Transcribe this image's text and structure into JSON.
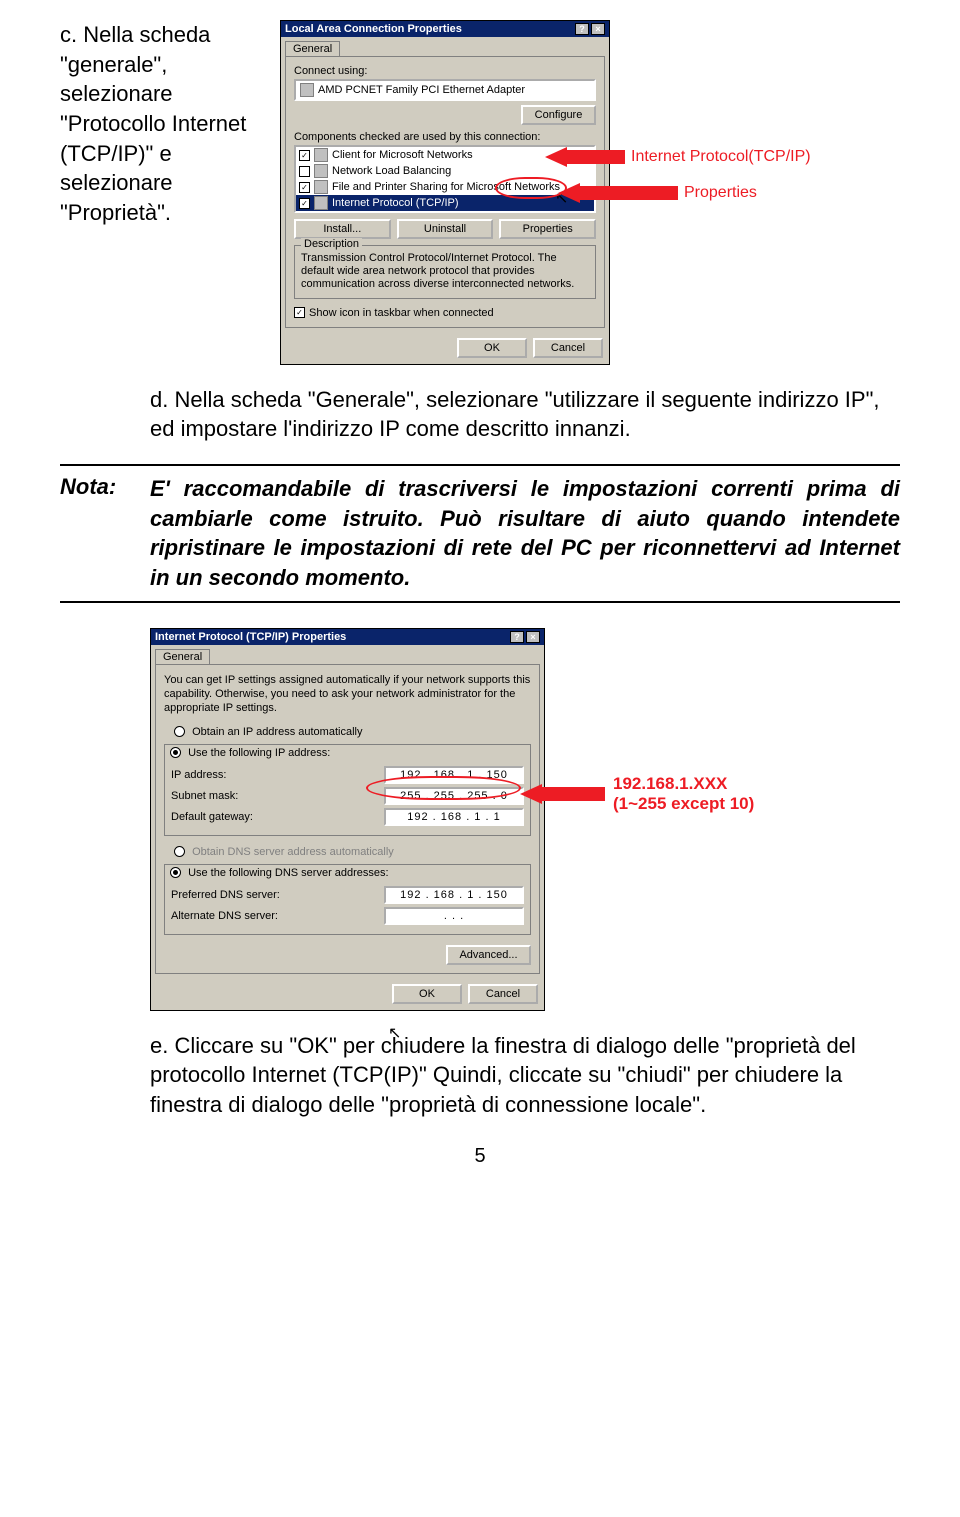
{
  "step_c": "c. Nella scheda \"generale\", selezionare \"Protocollo Internet (TCP/IP)\" e selezionare \"Proprietà\".",
  "step_d": "d. Nella scheda \"Generale\", selezionare \"utilizzare il seguente indirizzo IP\", ed impostare l'indirizzo IP come descritto innanzi.",
  "nota_label": "Nota:",
  "nota_body": "E' raccomandabile di trascriversi le impostazioni correnti prima di cambiarle come istruito. Può risultare di aiuto quando intendete ripristinare le impostazioni di rete del PC per riconnettervi ad Internet in un secondo momento.",
  "step_e": "e. Cliccare su \"OK\" per chiudere la finestra di dialogo delle \"proprietà del protocollo Internet (TCP(IP)\" Quindi, cliccate su \"chiudi\" per chiudere la finestra di dialogo delle \"proprietà di connessione locale\".",
  "page_number": "5",
  "dlg1": {
    "title": "Local Area Connection Properties",
    "tab_general": "General",
    "connect_using_lbl": "Connect using:",
    "adapter": "AMD PCNET Family PCI Ethernet Adapter",
    "configure_btn": "Configure",
    "components_lbl": "Components checked are used by this connection:",
    "items": [
      {
        "checked": true,
        "label": "Client for Microsoft Networks"
      },
      {
        "checked": false,
        "label": "Network Load Balancing"
      },
      {
        "checked": true,
        "label": "File and Printer Sharing for Microsoft Networks"
      },
      {
        "checked": true,
        "label": "Internet Protocol (TCP/IP)",
        "selected": true
      }
    ],
    "install_btn": "Install...",
    "uninstall_btn": "Uninstall",
    "properties_btn": "Properties",
    "desc_legend": "Description",
    "desc_body": "Transmission Control Protocol/Internet Protocol. The default wide area network protocol that provides communication across diverse interconnected networks.",
    "show_icon": "Show icon in taskbar when connected",
    "ok_btn": "OK",
    "cancel_btn": "Cancel",
    "callout_tcpip": "Internet Protocol(TCP/IP)",
    "callout_props": "Properties"
  },
  "dlg2": {
    "title": "Internet Protocol (TCP/IP) Properties",
    "tab_general": "General",
    "intro": "You can get IP settings assigned automatically if your network supports this capability. Otherwise, you need to ask your network administrator for the appropriate IP settings.",
    "radio_auto_ip": "Obtain an IP address automatically",
    "radio_use_ip": "Use the following IP address:",
    "ip_addr_lbl": "IP address:",
    "ip_addr_val": "192 . 168 .  1  . 150",
    "subnet_lbl": "Subnet mask:",
    "subnet_val": "255 . 255 . 255 .  0",
    "gateway_lbl": "Default gateway:",
    "gateway_val": "192 . 168 .  1  .  1",
    "radio_auto_dns": "Obtain DNS server address automatically",
    "radio_use_dns": "Use the following DNS server addresses:",
    "pref_dns_lbl": "Preferred DNS server:",
    "pref_dns_val": "192 . 168 .  1  . 150",
    "alt_dns_lbl": "Alternate DNS server:",
    "alt_dns_val": " .        .        .",
    "advanced_btn": "Advanced...",
    "ok_btn": "OK",
    "cancel_btn": "Cancel",
    "callout_line1": "192.168.1.XXX",
    "callout_line2": "(1~255 except 10)"
  }
}
